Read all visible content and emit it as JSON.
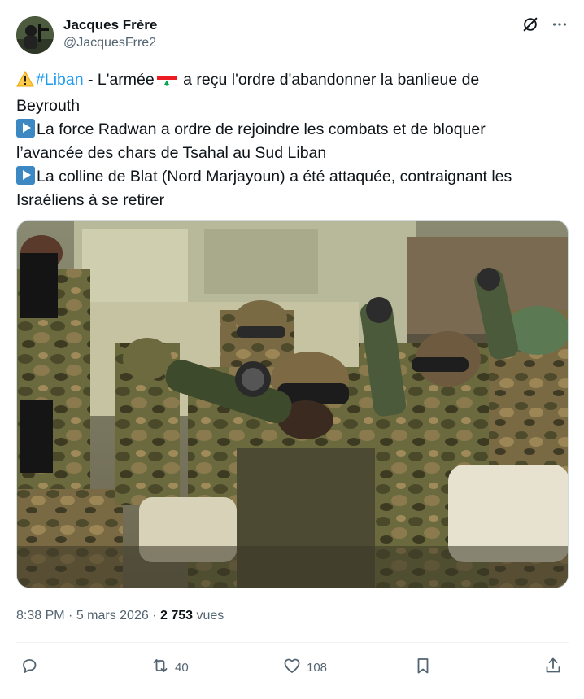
{
  "author": {
    "display_name": "Jacques Frère",
    "handle": "@JacquesFrre2"
  },
  "header_icons": [
    "grok-icon",
    "more-icon"
  ],
  "tweet": {
    "line1": {
      "emoji": "⚠️",
      "hashtag": "#Liban",
      "text_a": " - L'armée",
      "flag": "lebanon-flag",
      "text_b": " a reçu l'ordre d'abandonner la banlieue de"
    },
    "line2": "Beyrouth",
    "line3": "La force Radwan a ordre de rejoindre les combats et de bloquer",
    "line4": "l’avancée des chars de Tsahal au Sud Liban",
    "line5": "La colline de Blat (Nord Marjayoun) a été attaquée, contraignant les",
    "line6": "Israéliens à se retirer"
  },
  "meta": {
    "time": "8:38 PM",
    "sep1": " · ",
    "date": "5 mars 2026",
    "sep2": " · ",
    "views_count": "2 753",
    "views_label": " vues"
  },
  "actions": {
    "reply": "",
    "repost": "40",
    "like": "108",
    "bookmark": "",
    "share": ""
  },
  "colors": {
    "text": "#0f1419",
    "secondary": "#536471",
    "link": "#1d9bf0",
    "border": "#cfd9de"
  }
}
